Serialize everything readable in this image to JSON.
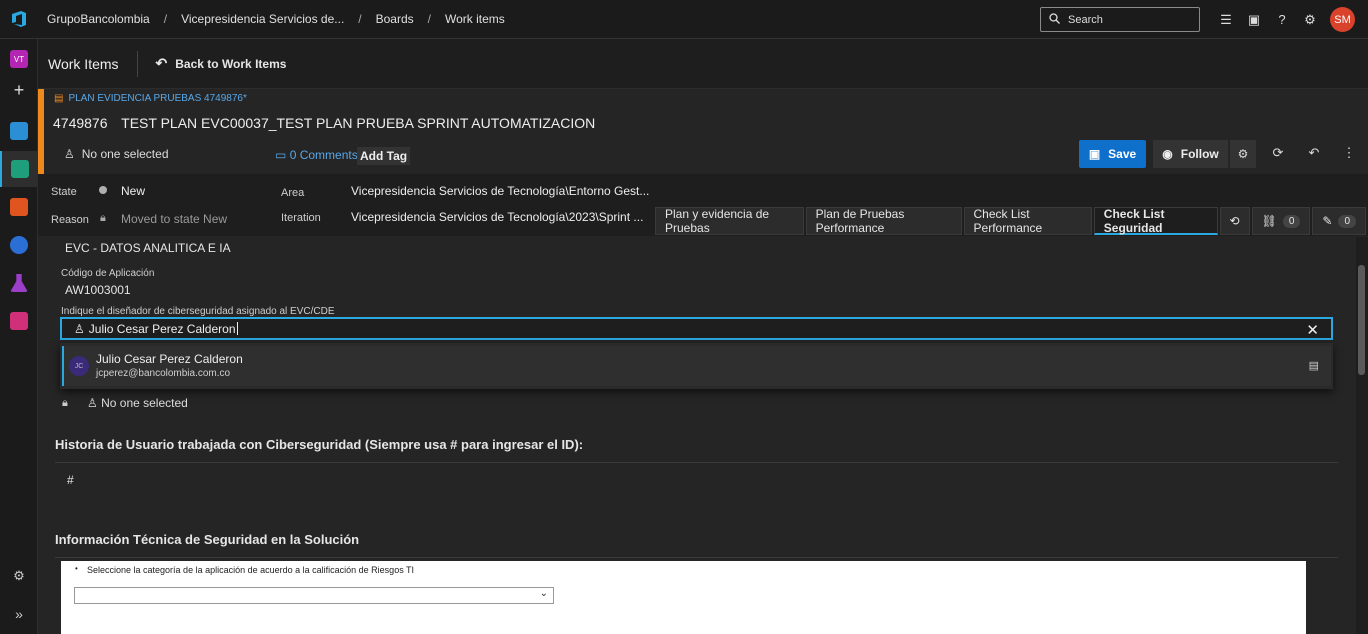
{
  "topbar": {
    "breadcrumbs": [
      "GrupoBancolombia",
      "Vicepresidencia Servicios de...",
      "Boards",
      "Work items"
    ],
    "search_placeholder": "Search",
    "user_initials": "SM",
    "icons": [
      "checklist-icon",
      "shopping-bag-icon",
      "help-icon",
      "user-settings-icon"
    ]
  },
  "leftnav": {
    "project_initials": "VT",
    "items": [
      "add-icon",
      "boards-icon",
      "work-items-icon",
      "repos-icon",
      "pipelines-icon",
      "test-plans-icon",
      "artifacts-icon"
    ],
    "bottom": [
      "settings-icon",
      "expand-icon"
    ]
  },
  "header": {
    "title": "Work Items",
    "back_label": "Back to Work Items"
  },
  "workitem": {
    "type_label": "PLAN EVIDENCIA PRUEBAS 4749876*",
    "id": "4749876",
    "title": "TEST PLAN EVC00037_TEST PLAN PRUEBA SPRINT AUTOMATIZACION",
    "assigned": "No one selected",
    "comments": "0 Comments",
    "add_tag": "Add Tag",
    "save_label": "Save",
    "follow_label": "Follow"
  },
  "fields": {
    "state_label": "State",
    "state_value": "New",
    "reason_label": "Reason",
    "reason_value": "Moved to state New",
    "area_label": "Area",
    "area_value": "Vicepresidencia Servicios de Tecnología\\Entorno Gest...",
    "iteration_label": "Iteration",
    "iteration_value": "Vicepresidencia Servicios de Tecnología\\2023\\Sprint ..."
  },
  "tabs": [
    {
      "label": "Plan y evidencia de Pruebas",
      "selected": false
    },
    {
      "label": "Plan de Pruebas Performance",
      "selected": false
    },
    {
      "label": "Check List Performance",
      "selected": false
    },
    {
      "label": "Check List Seguridad",
      "selected": true
    }
  ],
  "tab_counts": {
    "links": "0",
    "attachments": "0"
  },
  "form": {
    "evc_value": "EVC - DATOS ANALITICA E IA",
    "codigo_label": "Código de Aplicación",
    "codigo_value": "AW1003001",
    "disenador_label": "Indique el diseñador de ciberseguridad asignado al EVC/CDE",
    "disenador_input": "Julio Cesar Perez Calderon",
    "suggestion_name": "Julio Cesar Perez Calderon",
    "suggestion_email": "jcperez@bancolombia.com.co",
    "suggestion_initials": "JC",
    "second_assign": "No one selected",
    "historia_title": "Historia de Usuario trabajada con Ciberseguridad (Siempre usa # para ingresar el ID):",
    "historia_value": "#",
    "info_title": "Información Técnica de Seguridad en la Solución",
    "bullet_text": "Seleccione la categoría de la aplicación de acuerdo a la calificación de Riesgos TI"
  }
}
